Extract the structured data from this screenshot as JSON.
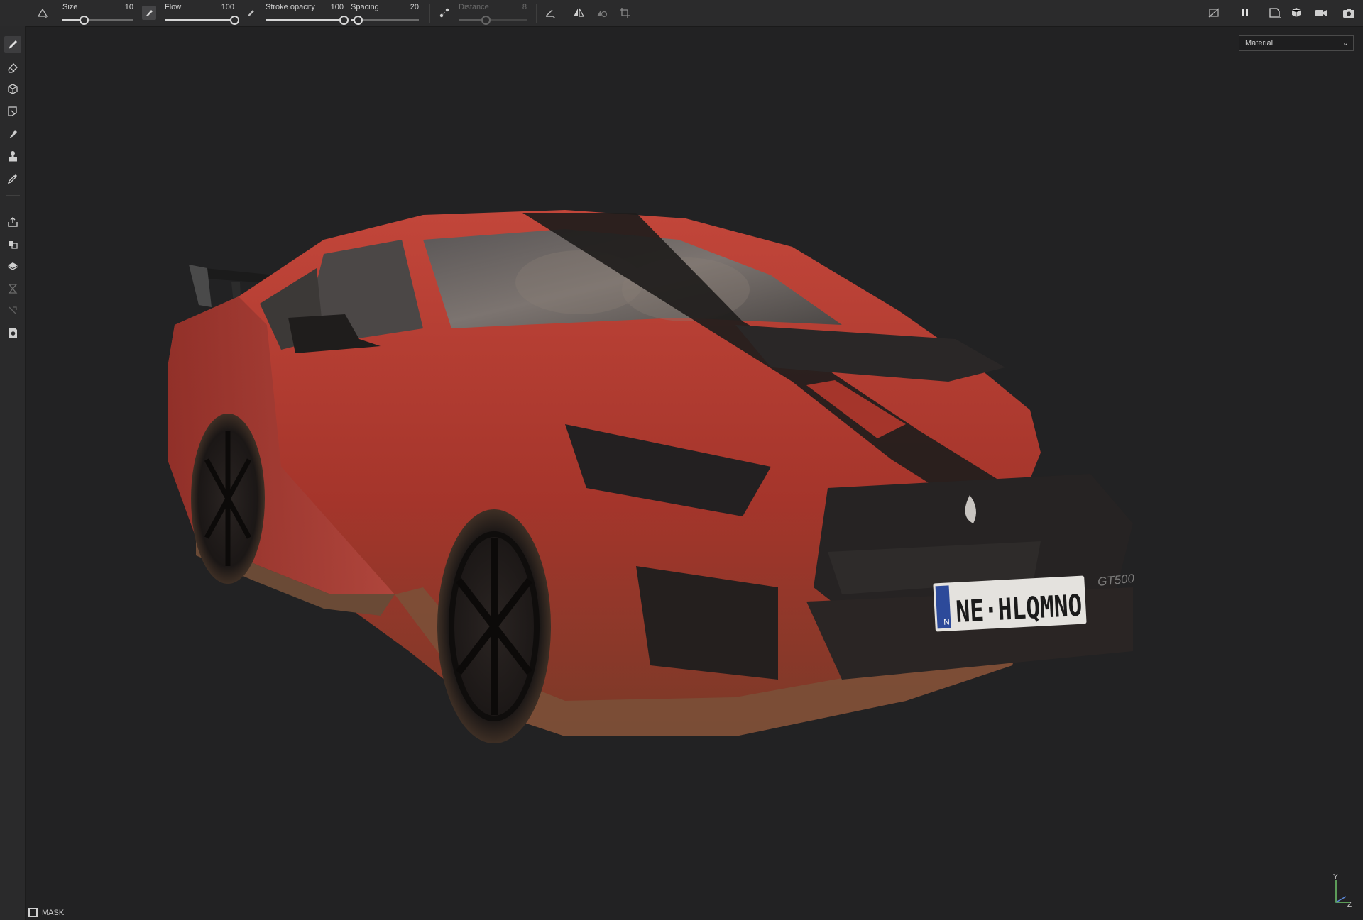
{
  "toolbar": {
    "brush_preset_icon": "brush-preset-icon",
    "size": {
      "label": "Size",
      "value": "10",
      "fraction": 0.3
    },
    "flow": {
      "label": "Flow",
      "value": "100",
      "fraction": 1.0
    },
    "stroke_opacity": {
      "label": "Stroke opacity",
      "value": "100",
      "fraction": 1.0
    },
    "spacing": {
      "label": "Spacing",
      "value": "20",
      "fraction": 0.1
    },
    "distance": {
      "label": "Distance",
      "value": "8",
      "fraction": 0.4,
      "enabled": false
    },
    "right_icons": [
      "hide-overlay-icon",
      "pause-icon",
      "camera-view-icon",
      "cube-view-icon",
      "video-icon",
      "screenshot-icon"
    ]
  },
  "viewport": {
    "display_mode": "Material",
    "license_plate": "NE·HLQMNO",
    "plate_country": "N",
    "grille_badge": "GT500"
  },
  "tools": [
    "paint-brush-icon",
    "eraser-icon",
    "projection-icon",
    "polygon-fill-icon",
    "smudge-icon",
    "clone-stamp-icon",
    "color-picker-icon",
    "export-icon",
    "bake-icon",
    "material-icon",
    "geometry-icon",
    "sequence-icon",
    "document-icon"
  ],
  "footer": {
    "mask_label": "MASK"
  },
  "axis": {
    "y": "Y",
    "z": "Z"
  },
  "colors": {
    "background": "#222223",
    "car_body": "#b8372d",
    "stripe": "#1f1d1c",
    "dirt": "#7a5138"
  }
}
